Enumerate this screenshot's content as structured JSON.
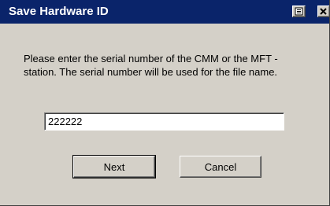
{
  "window": {
    "title": "Save Hardware ID",
    "help_icon": "help-icon",
    "close_icon": "close-icon"
  },
  "dialog": {
    "message": "Please enter the serial number of the CMM or the MFT - station. The serial number will be used for the file name.",
    "serial_value": "222222"
  },
  "buttons": {
    "next_label": "Next",
    "cancel_label": "Cancel"
  },
  "colors": {
    "titlebar": "#0a246a",
    "face": "#d4d0c8"
  }
}
